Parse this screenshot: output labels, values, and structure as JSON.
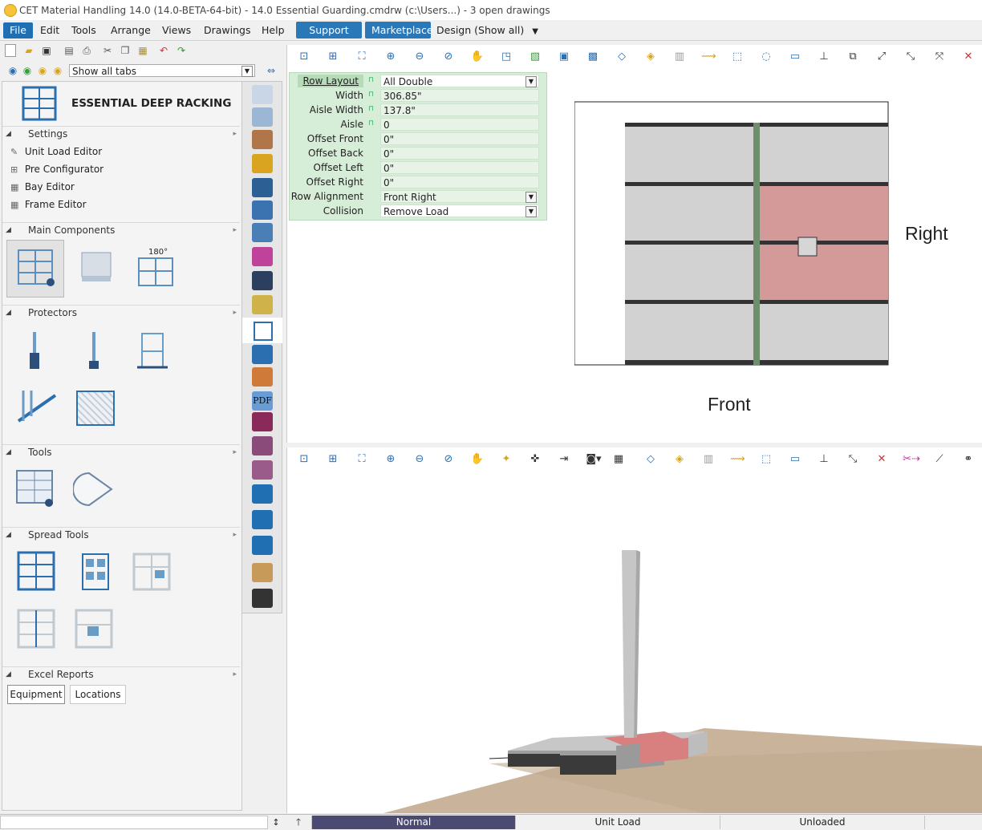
{
  "window": {
    "title": "CET Material Handling 14.0 (14.0-BETA-64-bit) - 14.0 Essential Guarding.cmdrw (c:\\Users...) - 3  open drawings"
  },
  "menu": {
    "items": [
      "File",
      "Edit",
      "Tools",
      "Arrange",
      "Views",
      "Drawings",
      "Help"
    ],
    "support": "Support",
    "marketplace": "Marketplace",
    "design": "Design (Show all)"
  },
  "left_toolbar": {
    "tab_select": "Show all tabs"
  },
  "panel": {
    "title": "ESSENTIAL DEEP RACKING",
    "sections": {
      "settings": "Settings",
      "main_components": "Main Components",
      "protectors": "Protectors",
      "tools": "Tools",
      "spread_tools": "Spread Tools",
      "excel_reports": "Excel Reports"
    },
    "settings_items": [
      "Unit Load Editor",
      "Pre Configurator",
      "Bay Editor",
      "Frame Editor"
    ],
    "badge_180": "180°",
    "excel_buttons": [
      "Equipment",
      "Locations"
    ]
  },
  "side_strip": {
    "pdf_label": "PDF"
  },
  "properties": [
    {
      "label": "Row Layout",
      "value": "All Double",
      "dropdown": true
    },
    {
      "label": "Width",
      "value": "306.85\"",
      "dropdown": false
    },
    {
      "label": "Aisle Width",
      "value": "137.8\"",
      "dropdown": false
    },
    {
      "label": "Aisle",
      "value": "0",
      "dropdown": false
    },
    {
      "label": "Offset Front",
      "value": "0\"",
      "dropdown": false
    },
    {
      "label": "Offset Back",
      "value": "0\"",
      "dropdown": false
    },
    {
      "label": "Offset Left",
      "value": "0\"",
      "dropdown": false
    },
    {
      "label": "Offset Right",
      "value": "0\"",
      "dropdown": false
    },
    {
      "label": "Row Alignment",
      "value": "Front Right",
      "dropdown": true
    },
    {
      "label": "Collision",
      "value": "Remove Load",
      "dropdown": true
    }
  ],
  "preview": {
    "right_label": "Right",
    "front_label": "Front"
  },
  "status": {
    "cells": [
      "Normal",
      "Unit Load",
      "Unloaded"
    ]
  },
  "colors": {
    "menu_active": "#1f6fb2",
    "highlight_bay": "#d49a9a",
    "grid_green": "#d6edd7",
    "floor": "#c9b39a"
  }
}
